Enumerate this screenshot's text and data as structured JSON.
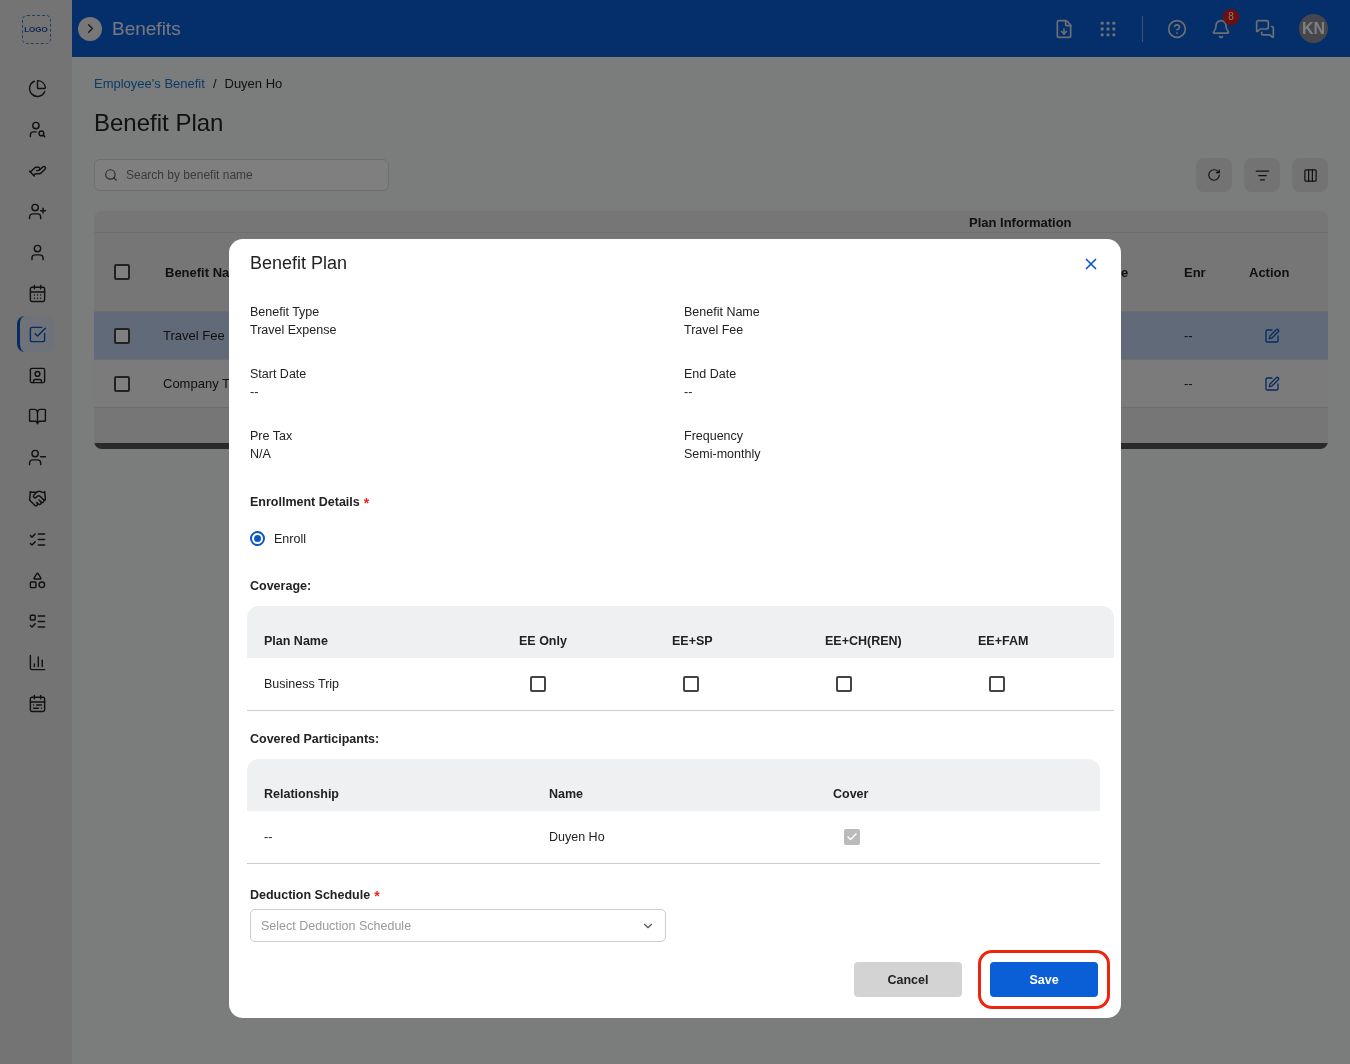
{
  "topbar": {
    "logo": "LOGO",
    "title": "Benefits",
    "notifications": "8",
    "avatar": "KN"
  },
  "sidebar": {
    "items": [
      {
        "selected": false
      },
      {
        "selected": false
      },
      {
        "selected": false
      },
      {
        "selected": false
      },
      {
        "selected": false
      },
      {
        "selected": false
      },
      {
        "selected": true
      },
      {
        "selected": false
      },
      {
        "selected": false
      },
      {
        "selected": false
      },
      {
        "selected": false
      },
      {
        "selected": false
      },
      {
        "selected": false
      },
      {
        "selected": false
      },
      {
        "selected": false
      },
      {
        "selected": false
      }
    ]
  },
  "breadcrumb": [
    {
      "label": "Employee's Benefit",
      "link": true
    },
    {
      "label": "Duyen Ho",
      "link": false
    }
  ],
  "breadcrumb_separator": "/",
  "page_title": "Benefit Plan",
  "search": {
    "placeholder": "Search by benefit name"
  },
  "table": {
    "group_header": "Plan Information",
    "select_all_checked": false,
    "columns": [
      "Benefit Na",
      "e",
      "Enr",
      "Action"
    ],
    "rows": [
      {
        "name": "Travel Fee",
        "enr": "--",
        "checked": false,
        "selected": true
      },
      {
        "name": "Company T",
        "enr": "--",
        "checked": false,
        "selected": false
      }
    ]
  },
  "modal": {
    "title": "Benefit Plan",
    "fields": [
      {
        "label": "Benefit Type",
        "value": "Travel Expense"
      },
      {
        "label": "Benefit Name",
        "value": "Travel Fee"
      },
      {
        "label": "Start Date",
        "value": "--"
      },
      {
        "label": "End Date",
        "value": "--"
      },
      {
        "label": "Pre Tax",
        "value": "N/A"
      },
      {
        "label": "Frequency",
        "value": "Semi-monthly"
      }
    ],
    "enrollment": {
      "label": "Enrollment Details",
      "required_mark": "*",
      "options": [
        {
          "label": "Enroll",
          "selected": true
        }
      ]
    },
    "coverage": {
      "label": "Coverage:",
      "columns": [
        "Plan Name",
        "EE Only",
        "EE+SP",
        "EE+CH(REN)",
        "EE+FAM"
      ],
      "rows": [
        {
          "plan": "Business Trip",
          "options": [
            {
              "checked": false
            },
            {
              "checked": false
            },
            {
              "checked": false
            },
            {
              "checked": false
            }
          ]
        }
      ]
    },
    "participants": {
      "label": "Covered Participants:",
      "columns": [
        "Relationship",
        "Name",
        "Cover"
      ],
      "rows": [
        {
          "relationship": "--",
          "name": "Duyen Ho",
          "checked": true,
          "disabled": true
        }
      ]
    },
    "deduction": {
      "label": "Deduction Schedule",
      "required_mark": "*",
      "placeholder": "Select Deduction Schedule"
    },
    "buttons": [
      {
        "label": "Cancel",
        "kind": "secondary",
        "highlighted": false
      },
      {
        "label": "Save",
        "kind": "primary",
        "highlighted": true
      }
    ]
  }
}
